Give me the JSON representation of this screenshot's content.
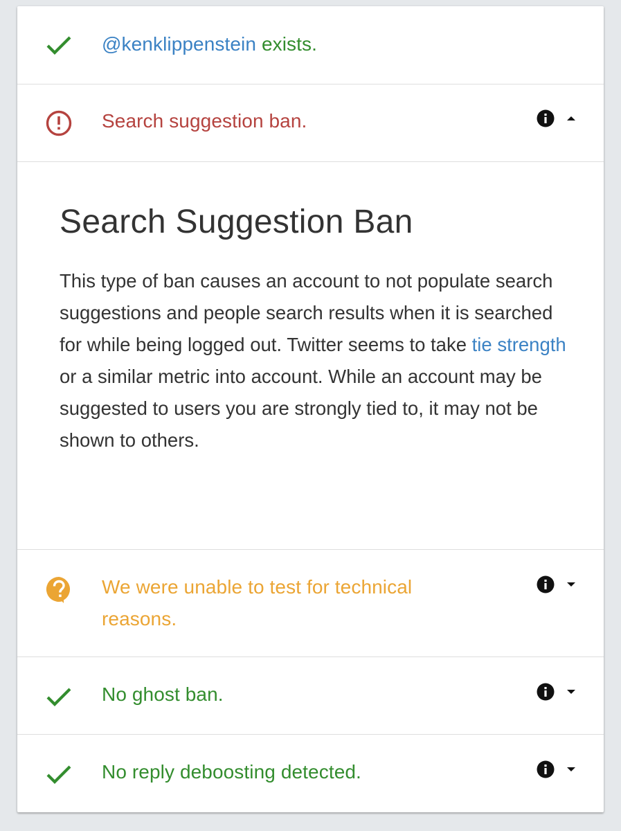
{
  "colors": {
    "ok": "#338d2e",
    "error": "#b5433f",
    "warning": "#eba534",
    "link": "#3b82c4",
    "text": "#333333"
  },
  "rows": {
    "exists": {
      "icon": "checkmark-icon",
      "handle": "@kenklippenstein",
      "text": "exists."
    },
    "search_suggestion": {
      "icon": "error-circle-icon",
      "text": "Search suggestion ban.",
      "info_icon": "info-icon",
      "caret_icon": "caret-up-icon"
    },
    "technical": {
      "icon": "question-bubble-icon",
      "line1": "We were unable to test for technical",
      "line2": "reasons.",
      "info_icon": "info-icon",
      "caret_icon": "caret-down-icon"
    },
    "ghost_ban": {
      "icon": "checkmark-icon",
      "text": "No ghost ban.",
      "info_icon": "info-icon",
      "caret_icon": "caret-down-icon"
    },
    "reply_deboosting": {
      "icon": "checkmark-icon",
      "text": "No reply deboosting detected.",
      "info_icon": "info-icon",
      "caret_icon": "caret-down-icon"
    }
  },
  "details": {
    "title": "Search Suggestion Ban",
    "body_before_link": "This type of ban causes an account to not populate search suggestions and people search results when it is searched for while being logged out. Twitter seems to take ",
    "link_text": "tie strength",
    "body_after_link": " or a similar metric into account. While an account may be suggested to users you are strongly tied to, it may not be shown to others."
  }
}
